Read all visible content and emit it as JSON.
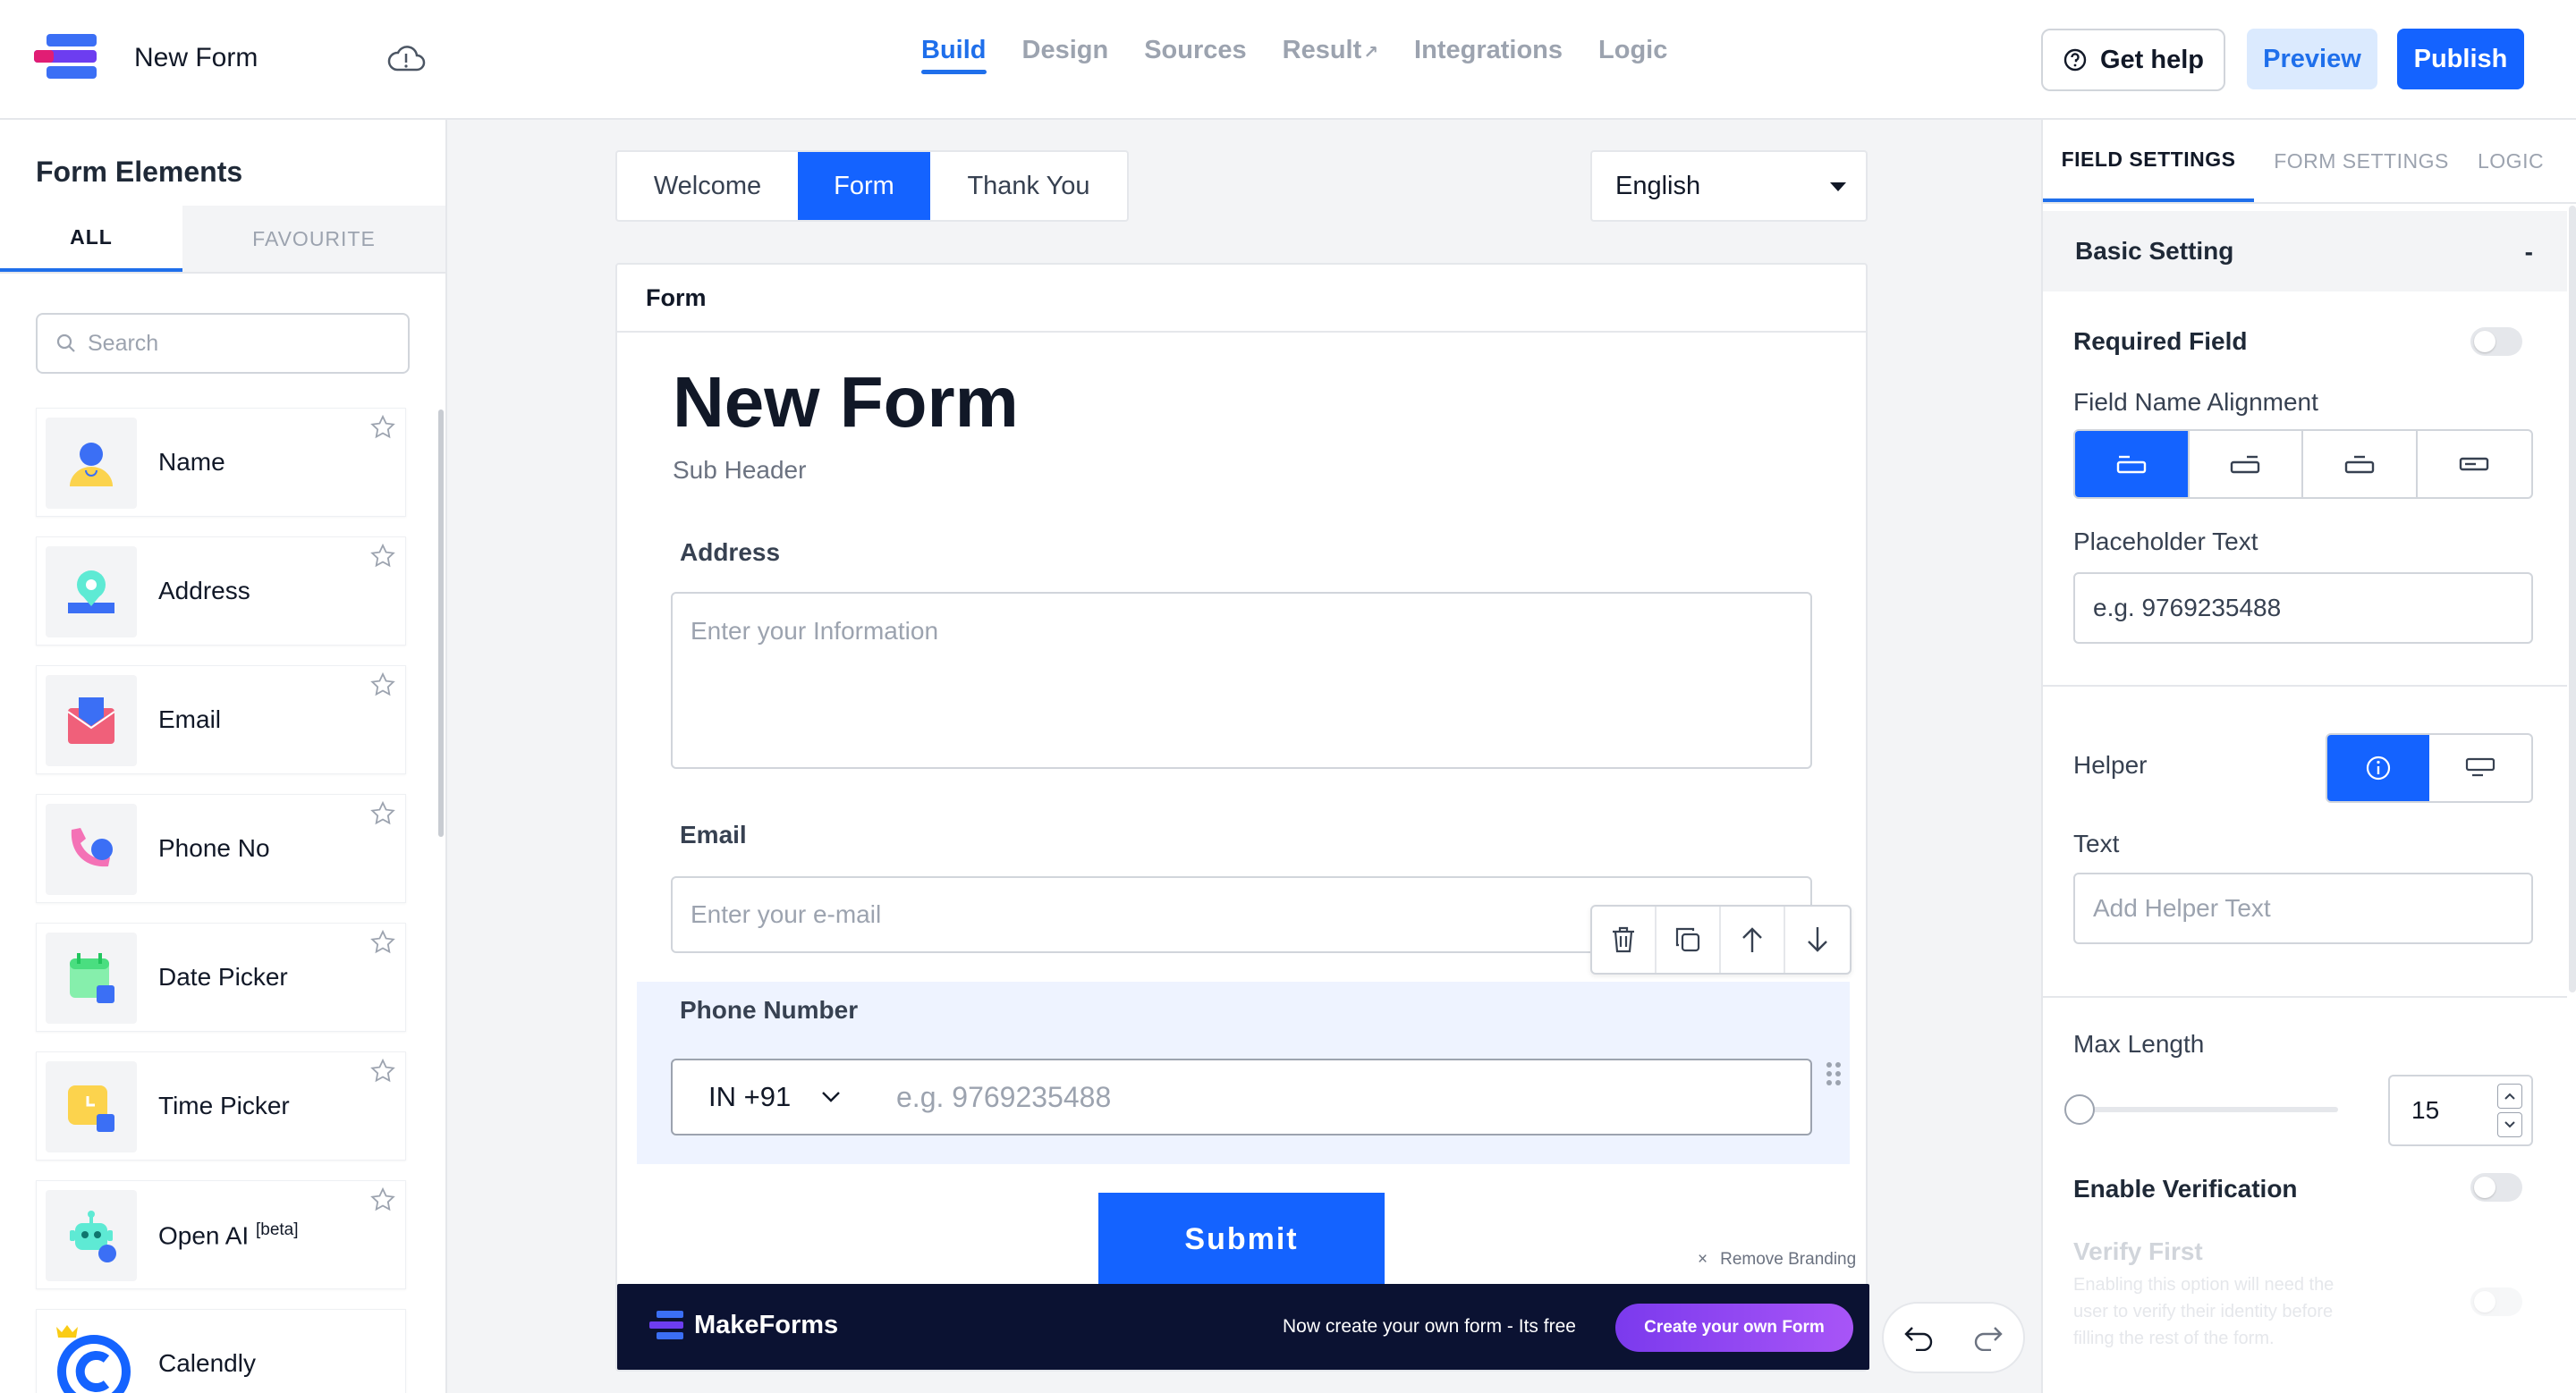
{
  "header": {
    "form_title": "New Form",
    "nav": [
      {
        "label": "Build",
        "active": true
      },
      {
        "label": "Design"
      },
      {
        "label": "Sources"
      },
      {
        "label": "Result"
      },
      {
        "label": "Integrations"
      },
      {
        "label": "Logic"
      }
    ],
    "get_help": "Get help",
    "preview": "Preview",
    "publish": "Publish"
  },
  "sidebar": {
    "title": "Form Elements",
    "tabs": [
      "ALL",
      "FAVOURITE"
    ],
    "search_placeholder": "Search",
    "items": [
      {
        "label": "Name",
        "icon": "person-icon"
      },
      {
        "label": "Address",
        "icon": "location-icon"
      },
      {
        "label": "Email",
        "icon": "envelope-icon"
      },
      {
        "label": "Phone No",
        "icon": "phone-icon"
      },
      {
        "label": "Date Picker",
        "icon": "calendar-icon"
      },
      {
        "label": "Time Picker",
        "icon": "clock-icon"
      },
      {
        "label": "Open AI",
        "sup": "[beta]",
        "icon": "robot-icon"
      },
      {
        "label": "Calendly",
        "icon": "calendly-icon"
      }
    ]
  },
  "canvas": {
    "page_tabs": [
      "Welcome",
      "Form",
      "Thank You"
    ],
    "active_tab": "Form",
    "language": "English",
    "card_title": "Form",
    "heading": "New Form",
    "sub_header": "Sub Header",
    "fields": {
      "address_label": "Address",
      "address_placeholder": "Enter your Information",
      "email_label": "Email",
      "email_placeholder": "Enter your e-mail",
      "phone_label": "Phone Number",
      "country_code": "IN +91",
      "phone_placeholder": "e.g. 9769235488"
    },
    "submit": "Submit",
    "remove_branding": "Remove Branding",
    "banner": {
      "brand": "MakeForms",
      "text": "Now create your own form - Its free",
      "cta": "Create your own Form"
    }
  },
  "settings": {
    "tabs": [
      "FIELD SETTINGS",
      "FORM SETTINGS",
      "LOGIC"
    ],
    "section": "Basic Setting",
    "collapse": "-",
    "required_field": "Required Field",
    "alignment_label": "Field Name Alignment",
    "placeholder_label": "Placeholder Text",
    "placeholder_value": "e.g. 9769235488",
    "helper_label": "Helper",
    "text_label": "Text",
    "helper_placeholder": "Add Helper Text",
    "max_length_label": "Max Length",
    "max_length_value": "15",
    "enable_verification": "Enable Verification",
    "verify_first": "Verify First",
    "verify_desc": "Enabling this option will need the user to verify their identity before filling the rest of the form."
  },
  "colors": {
    "primary": "#1463ff",
    "banner_bg": "#0b1232",
    "cta_gradient_start": "#7b3aed",
    "cta_gradient_end": "#a855f7"
  }
}
